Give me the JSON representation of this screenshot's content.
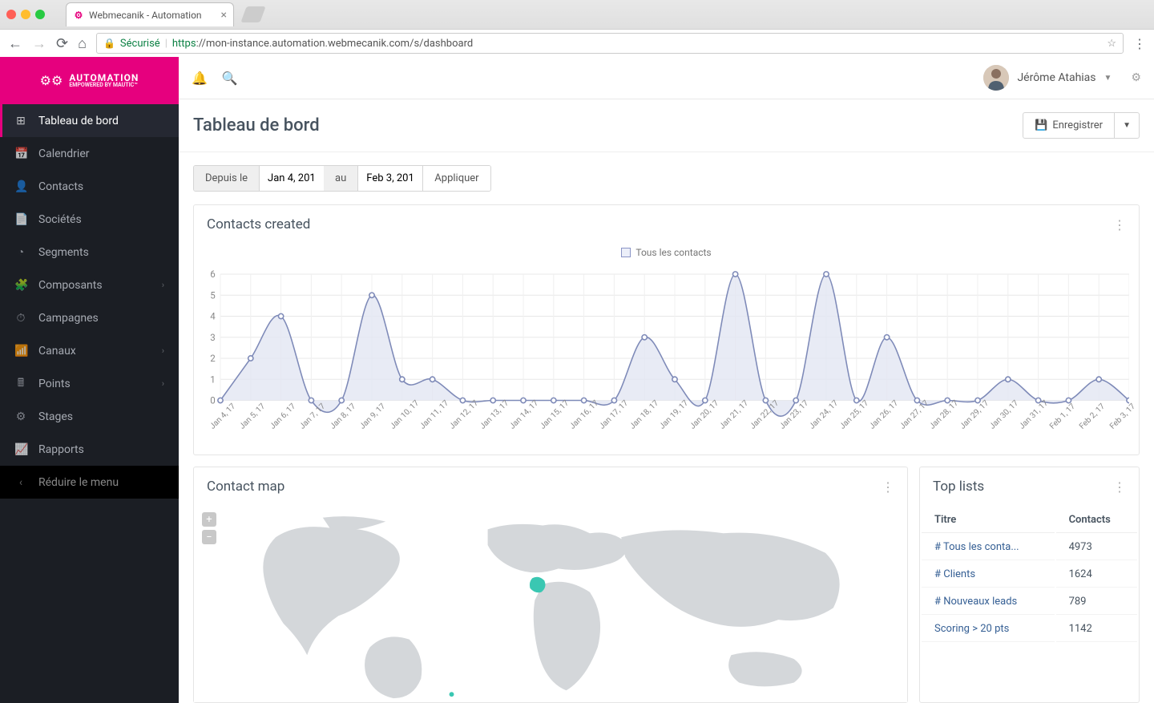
{
  "browser": {
    "tab_title": "Webmecanik - Automation",
    "secure_label": "Sécurisé",
    "url_proto": "https",
    "url_rest": "://mon-instance.automation.webmecanik.com/s/dashboard"
  },
  "brand": {
    "main": "AUTOMATION",
    "sub": "EMPOWERED BY MAUTIC™"
  },
  "sidebar": {
    "items": [
      {
        "icon": "⊞",
        "label": "Tableau de bord",
        "active": true
      },
      {
        "icon": "📅",
        "label": "Calendrier"
      },
      {
        "icon": "👤",
        "label": "Contacts"
      },
      {
        "icon": "📄",
        "label": "Sociétés"
      },
      {
        "icon": "◔",
        "label": "Segments"
      },
      {
        "icon": "🧩",
        "label": "Composants",
        "chev": true
      },
      {
        "icon": "⏱",
        "label": "Campagnes"
      },
      {
        "icon": "📶",
        "label": "Canaux",
        "chev": true
      },
      {
        "icon": "🖩",
        "label": "Points",
        "chev": true
      },
      {
        "icon": "⚙",
        "label": "Stages"
      },
      {
        "icon": "📈",
        "label": "Rapports"
      }
    ],
    "collapse_label": "Réduire le menu"
  },
  "user": {
    "name": "Jérôme Atahias"
  },
  "page": {
    "title": "Tableau de bord",
    "save_label": "Enregistrer"
  },
  "filter": {
    "from_label": "Depuis le",
    "from_value": "Jan 4, 201",
    "to_label": "au",
    "to_value": "Feb 3, 201",
    "apply_label": "Appliquer"
  },
  "contacts_panel": {
    "title": "Contacts created",
    "legend": "Tous les contacts"
  },
  "chart_data": {
    "type": "line",
    "title": "Contacts created",
    "ylabel": "",
    "ylim": [
      0,
      6
    ],
    "y_ticks": [
      0,
      1,
      2,
      3,
      4,
      5,
      6
    ],
    "categories": [
      "Jan 4, 17",
      "Jan 5, 17",
      "Jan 6, 17",
      "Jan 7, 17",
      "Jan 8, 17",
      "Jan 9, 17",
      "Jan 10, 17",
      "Jan 11, 17",
      "Jan 12, 17",
      "Jan 13, 17",
      "Jan 14, 17",
      "Jan 15, 17",
      "Jan 16, 17",
      "Jan 17, 17",
      "Jan 18, 17",
      "Jan 19, 17",
      "Jan 20, 17",
      "Jan 21, 17",
      "Jan 22, 17",
      "Jan 23, 17",
      "Jan 24, 17",
      "Jan 25, 17",
      "Jan 26, 17",
      "Jan 27, 17",
      "Jan 28, 17",
      "Jan 29, 17",
      "Jan 30, 17",
      "Jan 31, 17",
      "Feb 1, 17",
      "Feb 2, 17",
      "Feb 3, 17"
    ],
    "series": [
      {
        "name": "Tous les contacts",
        "values": [
          0,
          2,
          4,
          0,
          0,
          5,
          1,
          1,
          0,
          0,
          0,
          0,
          0,
          0,
          3,
          1,
          0,
          6,
          0,
          0,
          6,
          0,
          3,
          0,
          0,
          0,
          1,
          0,
          0,
          1,
          0
        ]
      }
    ],
    "color": "#7e8ab8",
    "fill": "#e2e6f2"
  },
  "map_panel": {
    "title": "Contact map",
    "highlight_country": "France"
  },
  "lists_panel": {
    "title": "Top lists",
    "cols": [
      "Titre",
      "Contacts"
    ],
    "rows": [
      {
        "t": "# Tous les conta...",
        "c": "4973"
      },
      {
        "t": "# Clients",
        "c": "1624"
      },
      {
        "t": "# Nouveaux leads",
        "c": "789"
      },
      {
        "t": "Scoring > 20 pts",
        "c": "1142"
      }
    ]
  }
}
